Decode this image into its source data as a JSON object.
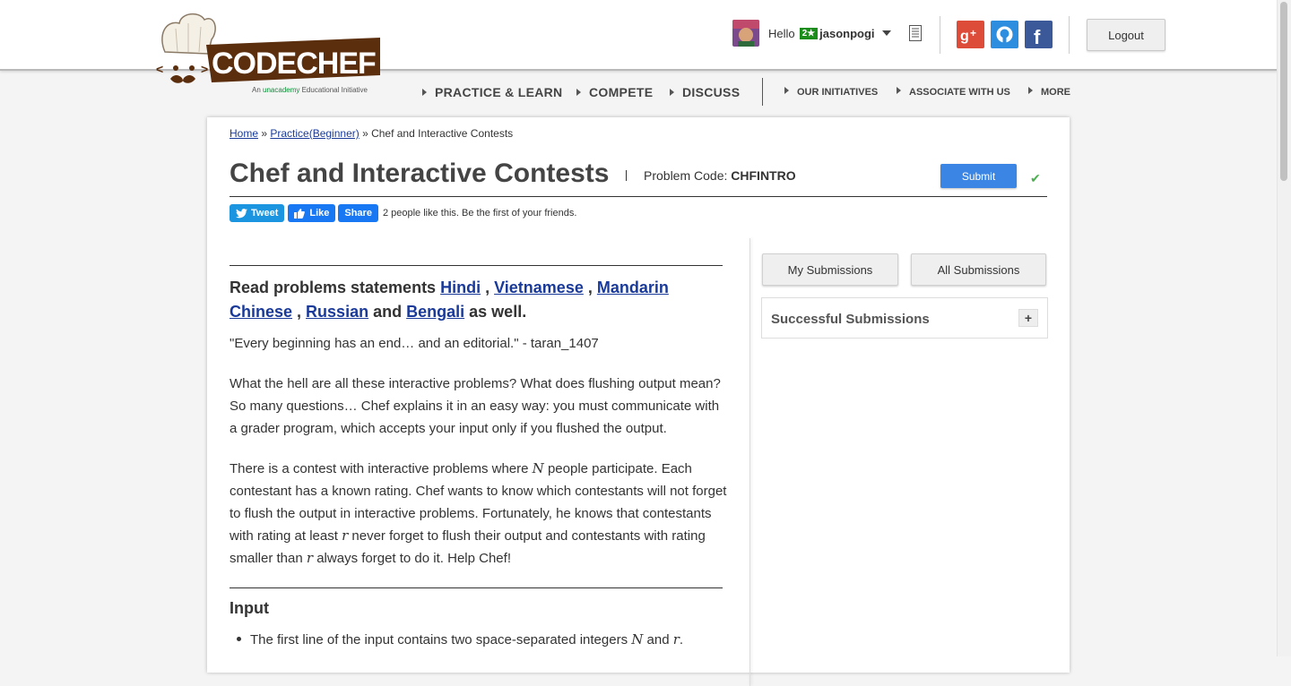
{
  "header": {
    "logo_text": "CODECHEF",
    "tagline_prefix": "An ",
    "tagline_brand": "unacademy",
    "tagline_suffix": " Educational Initiative",
    "hello": "Hello",
    "star_badge": "2★",
    "username": "jasonpogi",
    "logout_label": "Logout",
    "icons": [
      "notes-icon",
      "google-plus-icon",
      "github-icon",
      "facebook-icon"
    ]
  },
  "nav": {
    "main": [
      "PRACTICE & LEARN",
      "COMPETE",
      "DISCUSS"
    ],
    "secondary": [
      "OUR INITIATIVES",
      "ASSOCIATE WITH US",
      "MORE"
    ]
  },
  "breadcrumb": {
    "home": "Home",
    "sep": " » ",
    "practice": "Practice(Beginner)",
    "current": "Chef and Interactive Contests"
  },
  "problem": {
    "title": "Chef and Interactive Contests",
    "code_label": "Problem Code: ",
    "code": "CHFINTRO",
    "submit_label": "Submit"
  },
  "social": {
    "tweet": "Tweet",
    "like": "Like",
    "share": "Share",
    "like_text": "2 people like this. Be the first of your friends."
  },
  "statement": {
    "lang_prefix": "Read problems statements",
    "languages": [
      "Hindi",
      "Vietnamese",
      "Mandarin Chinese",
      "Russian",
      "Bengali"
    ],
    "lang_and": "and",
    "lang_suffix": "as well.",
    "quote": "\"Every beginning has an end… and an editorial.\" - taran_1407",
    "p1": "What the hell are all these interactive problems? What does flushing output mean? So many questions… Chef explains it in an easy way: you must communicate with a grader program, which accepts your input only if you flushed the output.",
    "p2_a": "There is a contest with interactive problems where ",
    "p2_N": "N",
    "p2_b": " people participate. Each contestant has a known rating. Chef wants to know which contestants will not forget to flush the output in interactive problems. Fortunately, he knows that contestants with rating at least ",
    "p2_r1": "r",
    "p2_c": " never forget to flush their output and contestants with rating smaller than ",
    "p2_r2": "r",
    "p2_d": " always forget to do it. Help Chef!",
    "input_heading": "Input",
    "bullet1_a": "The first line of the input contains two space-separated integers ",
    "bullet1_N": "N",
    "bullet1_and": " and ",
    "bullet1_r": "r",
    "bullet1_end": "."
  },
  "sidebar": {
    "my_submissions": "My Submissions",
    "all_submissions": "All Submissions",
    "successful_submissions": "Successful Submissions",
    "expand": "+"
  },
  "colors": {
    "brand_brown": "#5b2e0e",
    "submit_blue": "#3b86e4",
    "link_blue": "#1a3a99",
    "google_red": "#dd4b39",
    "github_blue": "#2d8ee0",
    "facebook_blue": "#3b5998"
  }
}
